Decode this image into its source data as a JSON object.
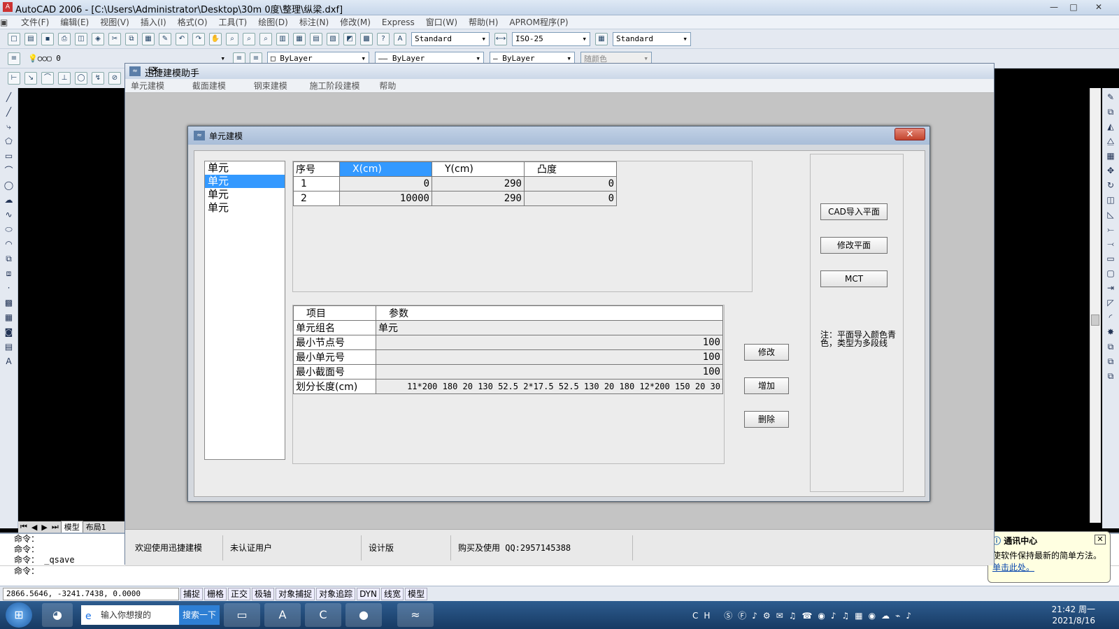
{
  "app": {
    "title": "AutoCAD 2006 - [C:\\Users\\Administrator\\Desktop\\30m 0度\\整理\\纵梁.dxf]",
    "menu": [
      "文件(F)",
      "编辑(E)",
      "视图(V)",
      "插入(I)",
      "格式(O)",
      "工具(T)",
      "绘图(D)",
      "标注(N)",
      "修改(M)",
      "Express",
      "窗口(W)",
      "帮助(H)",
      "APROM程序(P)"
    ],
    "text_style": "Standard",
    "dim_style": "ISO-25",
    "table_style": "Standard",
    "layer": "0",
    "color": "ByLayer",
    "linetype": "ByLayer",
    "lineweight": "ByLayer",
    "plotstyle": "随颜色",
    "tabs": {
      "model": "模型",
      "layout": "布局1"
    }
  },
  "command": {
    "lines": [
      "命令：",
      "命令：",
      "命令： _qsave",
      "命令："
    ]
  },
  "status": {
    "coords": "2866.5646, -3241.7438, 0.0000",
    "toggles": [
      "捕捉",
      "栅格",
      "正交",
      "极轴",
      "对象捕捉",
      "对象追踪",
      "DYN",
      "线宽",
      "模型"
    ]
  },
  "plugin": {
    "title": "迅捷建模助手",
    "menu": [
      "单元建模",
      "截面建模",
      "钢束建模",
      "施工阶段建模",
      "帮助"
    ],
    "footer": [
      "欢迎使用迅捷建模",
      "未认证用户",
      "设计版",
      "购买及使用 QQ:2957145388"
    ]
  },
  "dialog": {
    "title": "单元建模",
    "close": "✕",
    "list": [
      "单元",
      "单元",
      "单元",
      "单元"
    ],
    "selected_index": 1,
    "point_headers": [
      "序号",
      "X(cm)",
      "Y(cm)",
      "凸度"
    ],
    "points": [
      [
        "1",
        "0",
        "290",
        "0"
      ],
      [
        "2",
        "10000",
        "290",
        "0"
      ]
    ],
    "param_headers": [
      "项目",
      "参数"
    ],
    "params": [
      [
        "单元组名",
        "单元"
      ],
      [
        "最小节点号",
        "100"
      ],
      [
        "最小单元号",
        "100"
      ],
      [
        "最小截面号",
        "100"
      ],
      [
        "划分长度(cm)",
        "11*200 180 20 130 52.5 2*17.5 52.5 130 20 180 12*200 150 20 30"
      ]
    ],
    "buttons": {
      "modify": "修改",
      "add": "增加",
      "delete": "删除",
      "cad_import": "CAD导入平面",
      "modify_plane": "修改平面",
      "mct": "MCT"
    },
    "note": "注：平面导入颜色青色，类型为多段线"
  },
  "notification": {
    "title": "通讯中心",
    "body": "使软件保持最新的简单方法。",
    "link": "单击此处。"
  },
  "taskbar": {
    "search_placeholder": "输入你想搜的",
    "search_button": "搜索一下",
    "time": "21:42 周一",
    "date": "2021/8/16",
    "ime": "CH"
  }
}
